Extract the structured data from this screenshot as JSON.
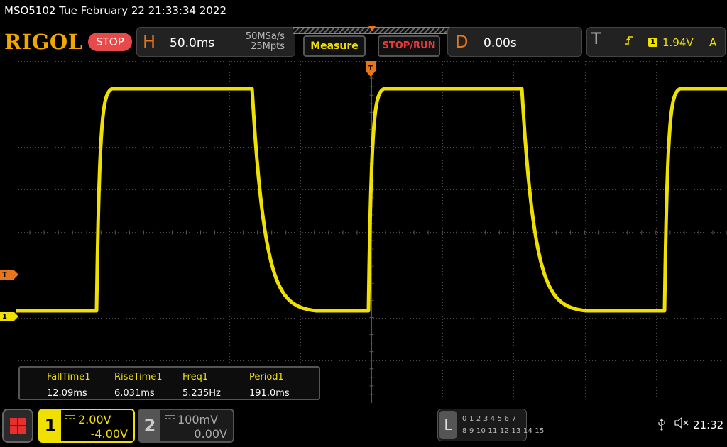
{
  "title_bar": {
    "text": "MSO5102  Tue February 22 21:33:34 2022"
  },
  "brand": {
    "logo": "RIGOL",
    "status": "STOP"
  },
  "horizontal": {
    "letter": "H",
    "timebase": "50.0ms",
    "sample_rate": "50MSa/s",
    "memory_depth": "25Mpts"
  },
  "buttons": {
    "measure": "Measure",
    "stop_run": "STOP/RUN"
  },
  "delay": {
    "letter": "D",
    "value": "0.00s"
  },
  "trigger": {
    "letter": "T",
    "source": "1",
    "level": "1.94V",
    "mode": "A",
    "edge_icon": "rising-edge-icon"
  },
  "markers": {
    "trigger_level": "T",
    "channel1": "1"
  },
  "measurements": [
    {
      "name": "FallTime1",
      "value": "12.09ms"
    },
    {
      "name": "RiseTime1",
      "value": "6.031ms"
    },
    {
      "name": "Freq1",
      "value": "5.235Hz"
    },
    {
      "name": "Period1",
      "value": "191.0ms"
    }
  ],
  "channels": {
    "ch1": {
      "number": "1",
      "coupling": "DC",
      "scale": "2.00V",
      "offset": "-4.00V",
      "color": "#f0e000"
    },
    "ch2": {
      "number": "2",
      "coupling": "DC",
      "scale": "100mV",
      "offset": "0.00V",
      "color": "#888888"
    }
  },
  "logic_analyzer": {
    "letter": "L",
    "row1": "0 1 2 3  4 5 6 7",
    "row2": "8 9 10 11 12 13 14 15"
  },
  "status": {
    "time": "21:32",
    "usb_icon": "usb-icon",
    "speaker_icon": "speaker-mute-icon"
  },
  "colors": {
    "accent_orange": "#e8751a",
    "channel1": "#f0e000",
    "stop_red": "#e74a4a",
    "logo": "#f0a800"
  }
}
